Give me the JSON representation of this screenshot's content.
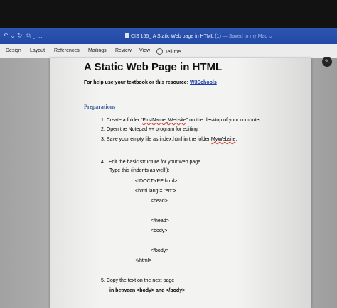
{
  "window": {
    "title": "CIS 165_ A Static Web page in HTML (1)",
    "saved_status": "— Saved to my Mac ⌄",
    "controls": [
      "↶ ⌄",
      "↻",
      "⎙ ⌄",
      "..."
    ]
  },
  "ribbon": {
    "tabs": [
      "Design",
      "Layout",
      "References",
      "Mailings",
      "Review",
      "View"
    ],
    "tell_me": "Tell me"
  },
  "document": {
    "title": "A Static Web Page in HTML",
    "help_text": "For help use your textbook or this resource:",
    "help_link": "W3Schools",
    "section_heading": "Preparations",
    "step1_pre": "1.  Create a folder \"",
    "step1_link": "FirstName_Website",
    "step1_post": "\" on the desktop of your computer.",
    "step2": "2.  Open the Notepad ++ program for editing.",
    "step3_pre": "3.  Save your empty file as index.html in the folder ",
    "step3_link": "MyWebsite",
    "step3_post": ".",
    "step4_num": "4.",
    "step4_text": "Edit the basic structure for your web page.",
    "step4_sub": "Type this (indents as well!):",
    "code": {
      "doctype": "<!DOCTYPE html>",
      "html_open": "<html lang = \"en\">",
      "head_open": "<head>",
      "head_close": "</head>",
      "body_open": "<body>",
      "body_close": "</body>",
      "html_close": "</html>"
    },
    "step5_line1": "5.  Copy the text on the next page",
    "step5_line2": "in between <body> and </body>"
  },
  "colors": {
    "titlebar": "#2148a6",
    "heading_blue": "#3a5f9a",
    "link": "#1a3fa8"
  }
}
